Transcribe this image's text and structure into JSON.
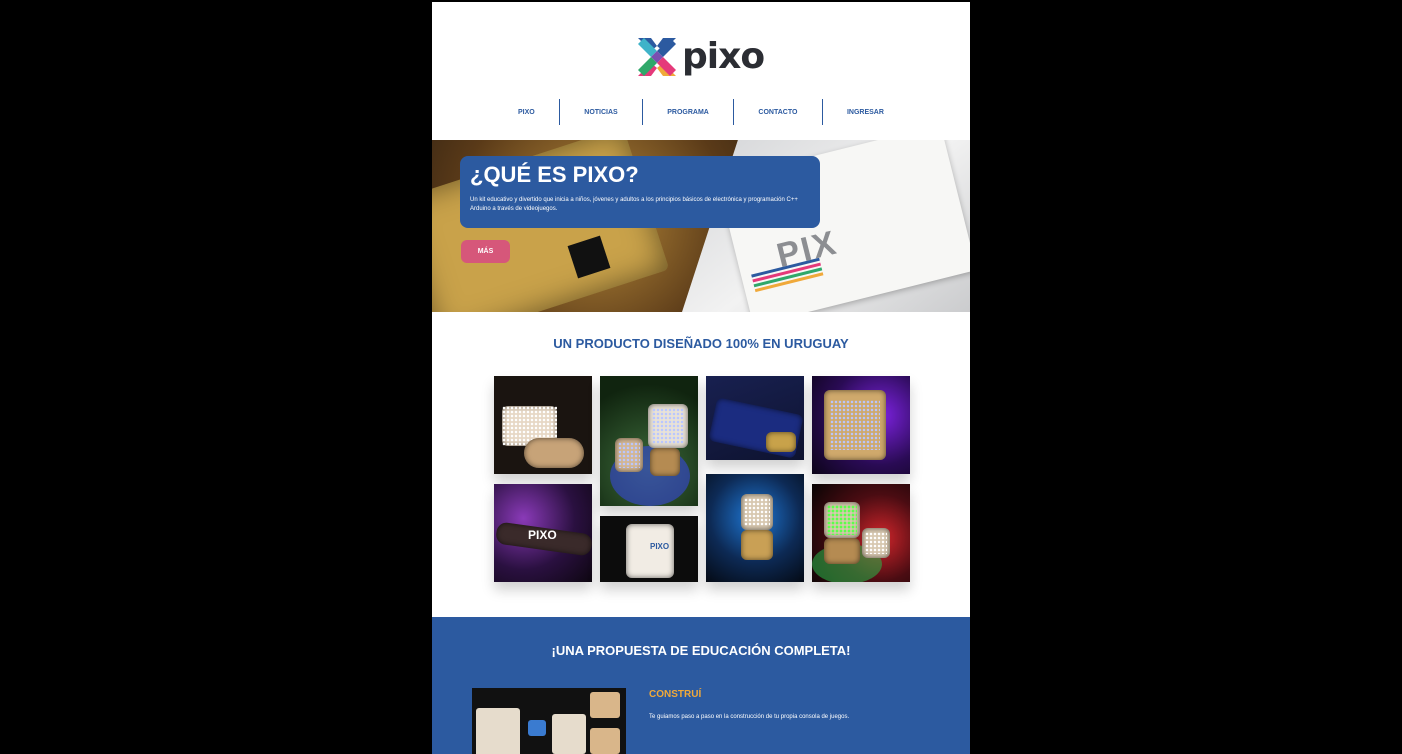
{
  "brand": {
    "name": "pixo",
    "logo_icon": "pixo-x-logo-icon"
  },
  "nav": {
    "items": [
      "PIXO",
      "NOTICIAS",
      "PROGRAMA",
      "CONTACTO",
      "INGRESAR"
    ]
  },
  "hero": {
    "title": "¿QUÉ ES PIXO?",
    "description": "Un kit educativo y divertido que inicia a niños, jóvenes y adultos a los principios básicos de electrónica y programación C++ Arduino a través de videojuegos.",
    "button_label": "MÁS",
    "booklet_word": "PIX"
  },
  "product": {
    "title": "UN PRODUCTO DISEÑADO 100% EN URUGUAY",
    "photos": [
      "photo-kit-parts",
      "photo-led-matrix-green",
      "photo-board-blue",
      "photo-console-purple",
      "photo-pixo-purple",
      "photo-box",
      "photo-console-blue",
      "photo-console-green-red"
    ],
    "box_label": "PIXO",
    "pixo_word": "PIXO"
  },
  "education": {
    "title": "¡UNA PROPUESTA DE EDUCACIÓN COMPLETA!",
    "subtitle": "CONSTRUÍ",
    "text": "Te guiamos paso a paso en la construcción de tu propia consola de juegos."
  },
  "colors": {
    "accent": "#2c5aa0",
    "button": "#d6577a",
    "highlight": "#f0a93a",
    "background": "#000000"
  }
}
